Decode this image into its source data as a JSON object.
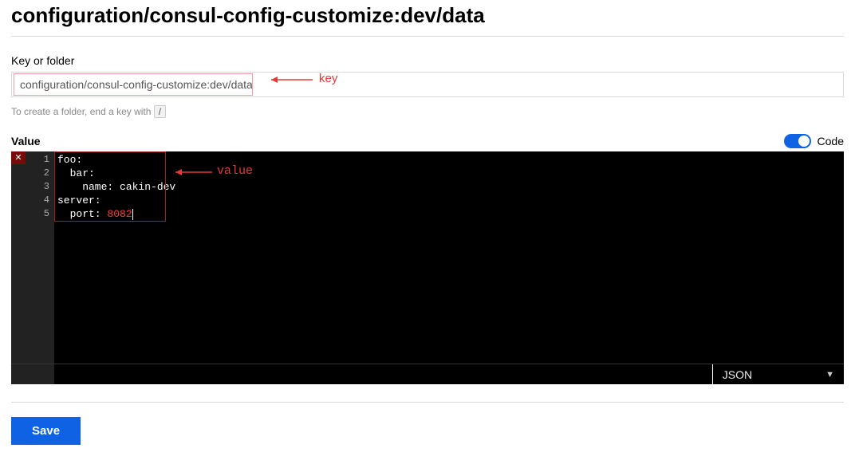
{
  "title": "configuration/consul-config-customize:dev/data",
  "form": {
    "key_label": "Key or folder",
    "key_value": "configuration/consul-config-customize:dev/data",
    "folder_hint_pre": "To create a folder, end a key with ",
    "folder_hint_key": "/",
    "value_label": "Value",
    "code_label": "Code"
  },
  "annotations": {
    "key_label": "key",
    "value_label": "value"
  },
  "editor": {
    "line_numbers": [
      "1",
      "2",
      "3",
      "4",
      "5"
    ],
    "lines": [
      {
        "text": "foo:"
      },
      {
        "text": "  bar:"
      },
      {
        "text": "    name: cakin-dev"
      },
      {
        "server": "server:"
      },
      {
        "port_label": "  port: ",
        "port_value": "8082"
      }
    ],
    "language": "JSON"
  },
  "buttons": {
    "save": "Save"
  }
}
